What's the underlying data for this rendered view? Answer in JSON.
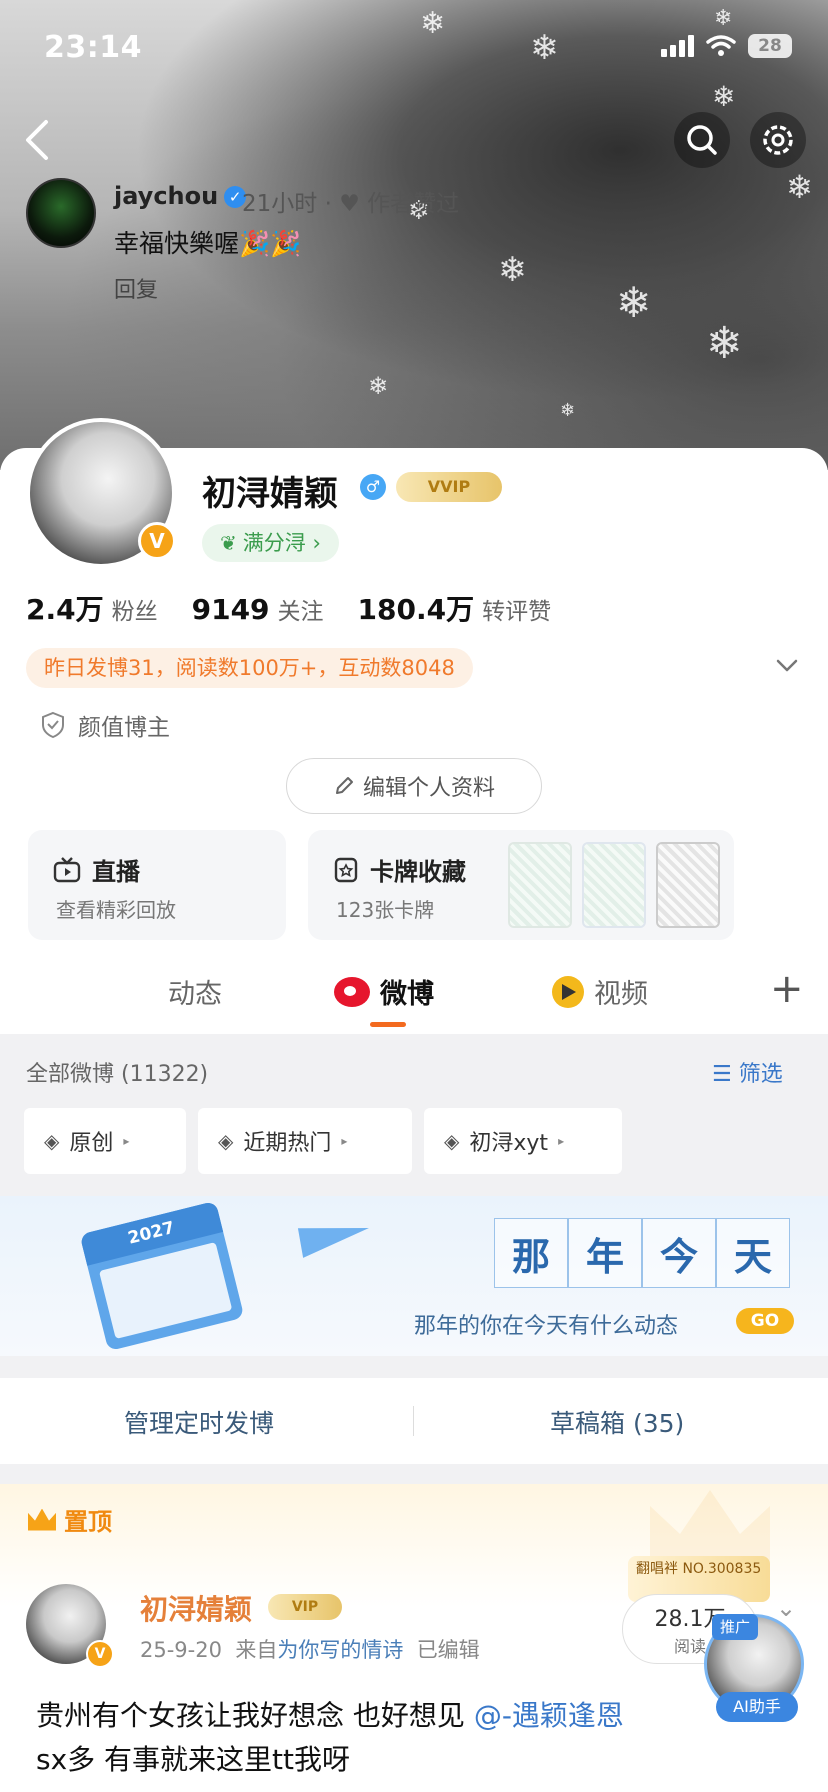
{
  "status_bar": {
    "time": "23:14",
    "battery": "28"
  },
  "comment": {
    "name": "jaychou",
    "meta": "21小时 · ♥ 作者赞过",
    "text": "幸福快樂喔🎉🎉",
    "reply": "回复"
  },
  "profile": {
    "name": "初浔婧颖",
    "gender": "♂",
    "vip": "VVIP",
    "score_pill": "满分浔 ›",
    "stats": [
      {
        "num": "2.4万",
        "label": "粉丝"
      },
      {
        "num": "9149",
        "label": "关注"
      },
      {
        "num": "180.4万",
        "label": "转评赞"
      }
    ],
    "info": "昨日发博31，阅读数100万+，互动数8048",
    "tag": "颜值博主",
    "edit_label": "编辑个人资料"
  },
  "cards": {
    "live_title": "直播",
    "live_sub": "查看精彩回放",
    "collect_title": "卡牌收藏",
    "collect_sub": "123张卡牌"
  },
  "tabs": {
    "dynamic": "动态",
    "weibo": "微博",
    "video": "视频",
    "plus": "+"
  },
  "filter": {
    "all_count": "全部微博 (11322)",
    "filter_label": "筛选",
    "chips": [
      "原创",
      "近期热门",
      "初浔xyt"
    ]
  },
  "memory": {
    "title_chars": [
      "那",
      "年",
      "今",
      "天"
    ],
    "subtitle": "那年的你在今天有什么动态",
    "go": "GO",
    "calendar_year": "2027"
  },
  "manage": {
    "left": "管理定时发博",
    "right": "草稿箱 (35)"
  },
  "pinned": {
    "label": "置顶",
    "name": "初浔婧颖",
    "vip": "VIP",
    "date": "25-9-20",
    "from_prefix": "来自",
    "source": "为你写的情诗",
    "edited": "已编辑",
    "fan_card": "翻唱袢 NO.300835",
    "reads": "28.1万",
    "reads_label": "阅读",
    "body_line1_pre": "贵州有个女孩让我好想念 也好想见 ",
    "mention": "@-遇颖逢恩",
    "body_line2": "sx多 有事就来这里tt我呀",
    "ad_tag": "推广",
    "ai_label": "AI助手"
  }
}
